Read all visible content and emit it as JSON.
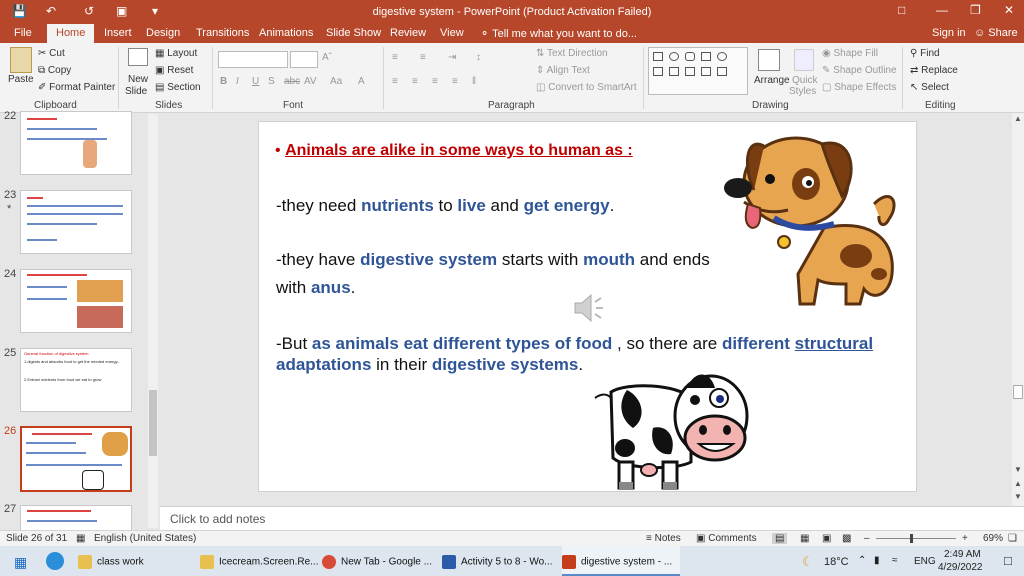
{
  "titlebar": {
    "title": "digestive system - PowerPoint (Product Activation Failed)",
    "sign_in": "Sign in",
    "share": "Share"
  },
  "tabs": [
    {
      "label": "File"
    },
    {
      "label": "Home"
    },
    {
      "label": "Insert"
    },
    {
      "label": "Design"
    },
    {
      "label": "Transitions"
    },
    {
      "label": "Animations"
    },
    {
      "label": "Slide Show"
    },
    {
      "label": "Review"
    },
    {
      "label": "View"
    }
  ],
  "tell_me": "Tell me what you want to do...",
  "ribbon": {
    "clipboard": {
      "paste": "Paste",
      "cut": "Cut",
      "copy": "Copy",
      "format_painter": "Format Painter",
      "label": "Clipboard"
    },
    "slides": {
      "new_slide_1": "New",
      "new_slide_2": "Slide",
      "layout": "Layout",
      "reset": "Reset",
      "section": "Section",
      "label": "Slides"
    },
    "font": {
      "label": "Font"
    },
    "paragraph": {
      "text_direction": "Text Direction",
      "align_text": "Align Text",
      "convert_smartart": "Convert to SmartArt",
      "label": "Paragraph"
    },
    "drawing": {
      "arrange": "Arrange",
      "quick_styles_1": "Quick",
      "quick_styles_2": "Styles",
      "shape_fill": "Shape Fill",
      "shape_outline": "Shape Outline",
      "shape_effects": "Shape Effects",
      "label": "Drawing"
    },
    "editing": {
      "find": "Find",
      "replace": "Replace",
      "select": "Select",
      "label": "Editing"
    }
  },
  "thumbnails": [
    {
      "num": "22",
      "star": "",
      "title": "3. Large Intestine"
    },
    {
      "num": "23",
      "star": "*",
      "title": "Digestion"
    },
    {
      "num": "24",
      "star": "",
      "title": "How can we keep digestive system healthy?"
    },
    {
      "num": "25",
      "star": "",
      "title": "General function of digestive system",
      "line1": "1.digests and absorbs food to get the needed energy..",
      "line2": "2.Extract nutrients from food we eat to grow"
    },
    {
      "num": "26",
      "star": "",
      "title": "Animals are alike in some ways to human as"
    },
    {
      "num": "27",
      "star": "",
      "title": "The digestive system of cow and dog"
    }
  ],
  "slide": {
    "bullet": "•",
    "heading": "Animals are alike in some ways to human as :",
    "l1a": "-they need ",
    "l1b": "nutrients",
    "l1c": " to ",
    "l1d": "live",
    "l1e": " and ",
    "l1f": "get energy",
    "l1g": ".",
    "l2a": "-they have ",
    "l2b": "digestive system",
    "l2c": " starts with ",
    "l2d": "mouth",
    "l2e": " and ends",
    "l3a": "with ",
    "l3b": "anus",
    "l3c": ".",
    "l4a": "-But ",
    "l4b": "as animals eat different types of food",
    "l4c": " , so there are ",
    "l4d": "different ",
    "l4e": "structural",
    "l5a": "adaptations",
    "l5b": " in their ",
    "l5c": "digestive systems",
    "l5d": "."
  },
  "notes_placeholder": "Click to add notes",
  "status": {
    "slide_count": "Slide 26 of 31",
    "language": "English (United States)",
    "notes": "Notes",
    "comments": "Comments",
    "zoom": "69%"
  },
  "taskbar": {
    "apps": [
      {
        "label": "class work"
      },
      {
        "label": "Icecream.Screen.Re..."
      },
      {
        "label": "New Tab - Google ..."
      },
      {
        "label": "Activity 5 to 8 - Wo..."
      },
      {
        "label": "digestive system - ..."
      }
    ],
    "temp": "18°C",
    "lang": "ENG",
    "time": "2:49 AM",
    "date": "4/29/2022"
  },
  "colors": {
    "accent": "#b7472a",
    "emphasis_blue": "#2f5597",
    "emphasis_red": "#c00000"
  }
}
